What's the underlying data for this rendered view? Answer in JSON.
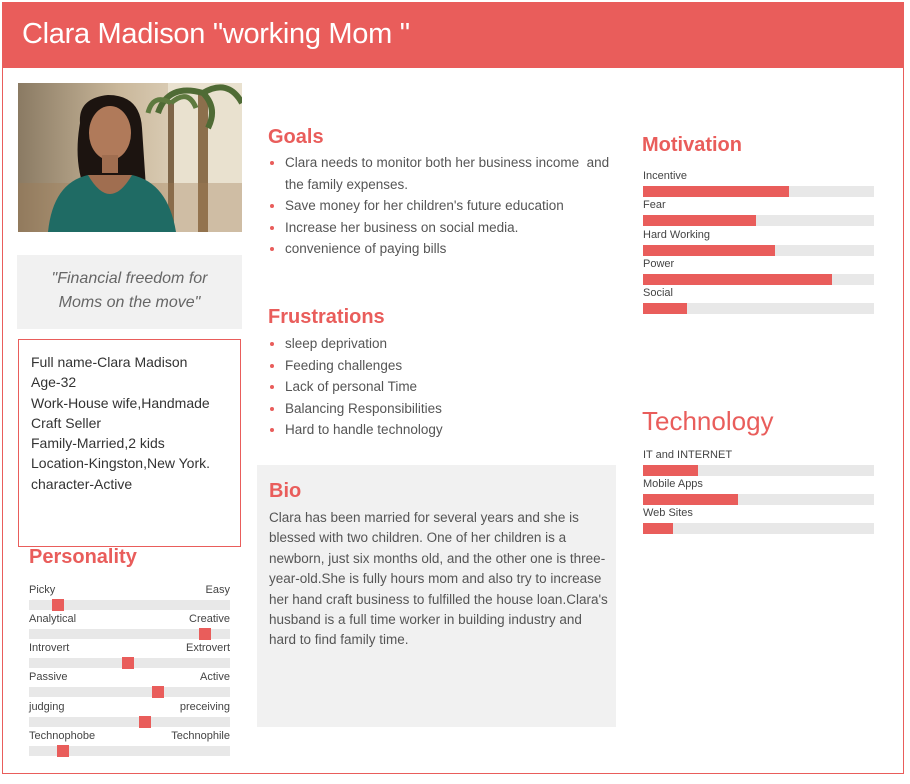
{
  "header": {
    "title": "Clara Madison \"working Mom \""
  },
  "colors": {
    "accent": "#e95d5b",
    "panel": "#f1f1f1",
    "track": "#e8e8e8"
  },
  "photo": {
    "icon": "persona-photo"
  },
  "quote": {
    "line1": "\"Financial freedom for",
    "line2": "Moms on the move\""
  },
  "info": {
    "lines": [
      "Full name-Clara Madison",
      "Age-32",
      "Work-House wife,Handmade",
      "Craft Seller",
      "Family-Married,2 kids",
      "Location-Kingston,New York.",
      "character-Active"
    ]
  },
  "goals": {
    "title": "Goals",
    "items": [
      "Clara needs to monitor both her business income  and the family expenses.",
      "Save money for her children's future education",
      "Increase her business on social media.",
      "convenience of paying bills"
    ]
  },
  "frustrations": {
    "title": "Frustrations",
    "items": [
      "sleep deprivation",
      "Feeding challenges",
      "Lack of personal Time",
      "Balancing Responsibilities",
      "Hard to handle technology"
    ]
  },
  "bio": {
    "title": "Bio",
    "text": "Clara has been married for several years and she  is  blessed with two children. One of her children is a newborn, just six months old, and the other one is  three-year-old.She is fully hours mom and also try to increase her hand craft business to fulfilled the house loan.Clara's husband is a full time worker in building industry and hard to find family time."
  },
  "motivation": {
    "title": "Motivation",
    "items": [
      {
        "label": "Incentive",
        "value": 0.63
      },
      {
        "label": "Fear",
        "value": 0.49
      },
      {
        "label": "Hard Working",
        "value": 0.57
      },
      {
        "label": "Power",
        "value": 0.82
      },
      {
        "label": "Social",
        "value": 0.19
      }
    ]
  },
  "technology": {
    "title": "Technology",
    "items": [
      {
        "label": "IT and INTERNET",
        "value": 0.24
      },
      {
        "label": "Mobile Apps",
        "value": 0.41
      },
      {
        "label": "Web Sites",
        "value": 0.13
      }
    ]
  },
  "personality": {
    "title": "Personality",
    "items": [
      {
        "left": "Picky",
        "right": "Easy",
        "value": 0.12
      },
      {
        "left": "Analytical",
        "right": "Creative",
        "value": 0.9
      },
      {
        "left": "Introvert",
        "right": "Extrovert",
        "value": 0.49
      },
      {
        "left": "Passive",
        "right": "Active",
        "value": 0.65
      },
      {
        "left": "judging",
        "right": "preceiving",
        "value": 0.58
      },
      {
        "left": "Technophobe",
        "right": "Technophile",
        "value": 0.15
      }
    ]
  }
}
